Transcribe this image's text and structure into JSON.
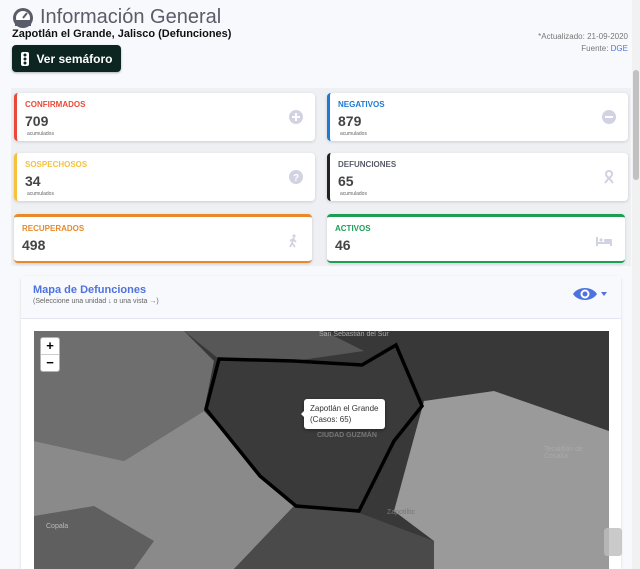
{
  "header": {
    "title": "Información General",
    "location": "Zapotlán el Grande, Jalisco (Defunciones)",
    "updated": "*Actualizado: 21-09-2020",
    "source_label": "Fuente:",
    "source_link": "DGE",
    "semaforo_button": "Ver semáforo"
  },
  "cards": {
    "confirmados": {
      "label": "CONFIRMADOS",
      "value": "709",
      "sub": "acumulados",
      "color": "#e74a3b",
      "icon": "plus-circle-icon"
    },
    "negativos": {
      "label": "NEGATIVOS",
      "value": "879",
      "sub": "acumulados",
      "color": "#1f78d1",
      "icon": "minus-circle-icon"
    },
    "sospechosos": {
      "label": "SOSPECHOSOS",
      "value": "34",
      "sub": "acumulados",
      "color": "#f6c23e",
      "icon": "question-circle-icon"
    },
    "defunciones": {
      "label": "DEFUNCIONES",
      "value": "65",
      "sub": "acumulados",
      "color": "#5a5c69",
      "icon": "ribbon-icon"
    },
    "recuperados": {
      "label": "RECUPERADOS",
      "value": "498",
      "color": "#e88a2b",
      "icon": "walking-icon"
    },
    "activos": {
      "label": "ACTIVOS",
      "value": "46",
      "color": "#1e9e55",
      "icon": "bed-icon"
    }
  },
  "map": {
    "title": "Mapa de Defunciones",
    "subtitle": "(Seleccione una unidad ↓ o una vista →)",
    "zoom_in": "+",
    "zoom_out": "−",
    "tooltip_name": "Zapotlán el Grande",
    "tooltip_cases": "(Casos: 65)",
    "labels": [
      "San Sebastián del Sur",
      "CIUDAD GUZMÁN",
      "Tecalitlán de Cosalía",
      "Zapotiltic",
      "Copala"
    ]
  }
}
